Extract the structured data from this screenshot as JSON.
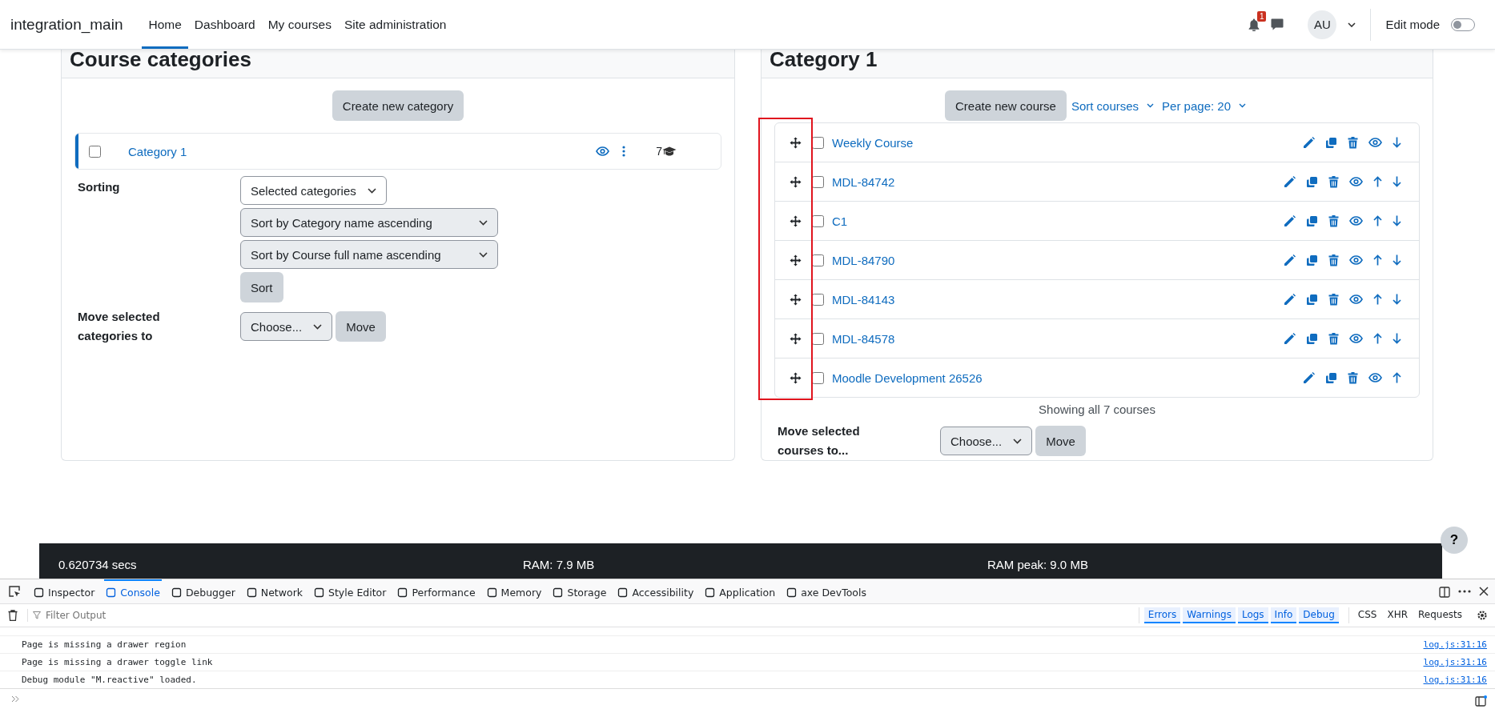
{
  "navbar": {
    "site_name": "integration_main",
    "nav_items": [
      {
        "label": "Home",
        "selected": true
      },
      {
        "label": "Dashboard",
        "selected": false
      },
      {
        "label": "My courses",
        "selected": false
      },
      {
        "label": "Site administration",
        "selected": false
      }
    ],
    "notification_count": "1",
    "avatar_initials": "AU",
    "edit_mode": {
      "label": "Edit mode",
      "on": false
    }
  },
  "categories_panel": {
    "title": "Course categories",
    "create_button": "Create new category",
    "categories": [
      {
        "name": "Category 1",
        "selected": true,
        "checked": false,
        "course_count": "7"
      }
    ],
    "sorting": {
      "label": "Sorting",
      "scope_select": "Selected categories",
      "category_sort_select": "Sort by Category name ascending",
      "course_sort_select": "Sort by Course full name ascending",
      "sort_button": "Sort"
    },
    "move": {
      "label": "Move selected categories to",
      "select": "Choose...",
      "button": "Move"
    }
  },
  "category_panel": {
    "title": "Category 1",
    "create_button": "Create new course",
    "sort_menu": "Sort courses",
    "per_page_menu": "Per page: 20",
    "drag_handles_highlighted": true,
    "courses": [
      {
        "name": "Weekly Course",
        "checked": false,
        "can_move_up": false,
        "can_move_down": true
      },
      {
        "name": "MDL-84742",
        "checked": false,
        "can_move_up": true,
        "can_move_down": true
      },
      {
        "name": "C1",
        "checked": false,
        "can_move_up": true,
        "can_move_down": true
      },
      {
        "name": "MDL-84790",
        "checked": false,
        "can_move_up": true,
        "can_move_down": true
      },
      {
        "name": "MDL-84143",
        "checked": false,
        "can_move_up": true,
        "can_move_down": true
      },
      {
        "name": "MDL-84578",
        "checked": false,
        "can_move_up": true,
        "can_move_down": true
      },
      {
        "name": "Moodle Development 26526",
        "checked": false,
        "can_move_up": true,
        "can_move_down": false
      }
    ],
    "summary": "Showing all 7 courses",
    "move": {
      "label": "Move selected courses to...",
      "select": "Choose...",
      "button": "Move"
    }
  },
  "footer": {
    "time": "0.620734 secs",
    "ram": "RAM: 7.9 MB",
    "ram_peak": "RAM peak: 9.0 MB"
  },
  "help_button": "?",
  "devtools": {
    "tabs": [
      {
        "label": "Inspector",
        "selected": false
      },
      {
        "label": "Console",
        "selected": true
      },
      {
        "label": "Debugger",
        "selected": false
      },
      {
        "label": "Network",
        "selected": false
      },
      {
        "label": "Style Editor",
        "selected": false
      },
      {
        "label": "Performance",
        "selected": false
      },
      {
        "label": "Memory",
        "selected": false
      },
      {
        "label": "Storage",
        "selected": false
      },
      {
        "label": "Accessibility",
        "selected": false
      },
      {
        "label": "Application",
        "selected": false
      },
      {
        "label": "axe DevTools",
        "selected": false
      }
    ],
    "filter_placeholder": "Filter Output",
    "level_filters": [
      {
        "label": "Errors",
        "selected": true
      },
      {
        "label": "Warnings",
        "selected": true
      },
      {
        "label": "Logs",
        "selected": true
      },
      {
        "label": "Info",
        "selected": true
      },
      {
        "label": "Debug",
        "selected": true
      }
    ],
    "type_filters": [
      {
        "label": "CSS",
        "selected": false
      },
      {
        "label": "XHR",
        "selected": false
      },
      {
        "label": "Requests",
        "selected": false
      }
    ],
    "messages": [
      {
        "text": "Page is missing a drawer region",
        "source": "log.js:31:16"
      },
      {
        "text": "Page is missing a drawer toggle link",
        "source": "log.js:31:16"
      },
      {
        "text": "Debug module \"M.reactive\" loaded.",
        "source": "log.js:31:16"
      }
    ]
  }
}
